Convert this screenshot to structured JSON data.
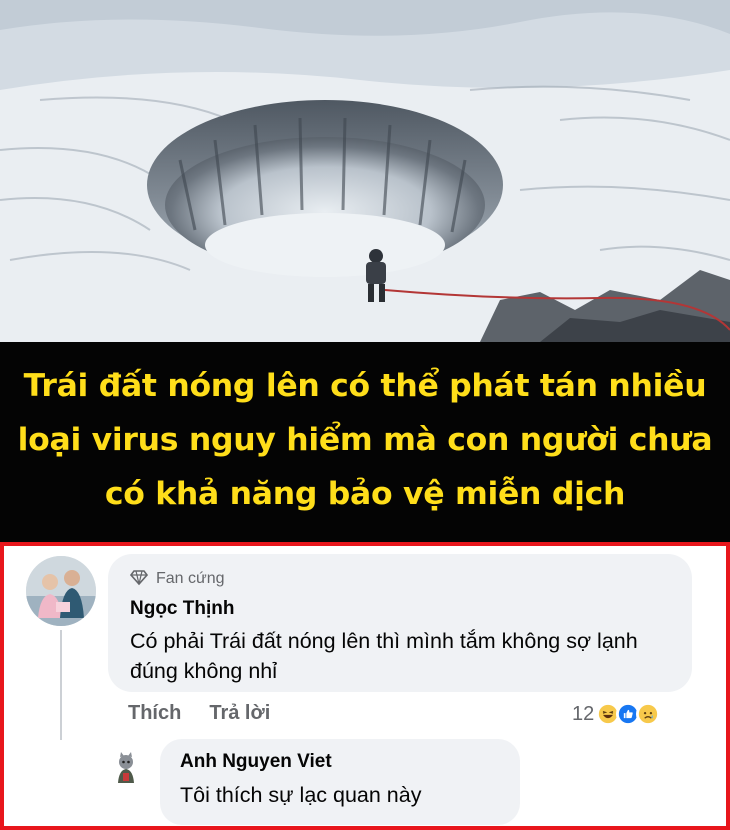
{
  "post": {
    "headline": "Trái đất nóng lên có thể phát tán nhiều loại virus nguy hiểm mà con người chưa có khả năng bảo vệ miễn dịch"
  },
  "comments": [
    {
      "badge": "Fan cứng",
      "author": "Ngọc Thịnh",
      "text": "Có phải Trái đất nóng lên thì mình tắm không sợ lạnh đúng không nhỉ",
      "actions": {
        "like": "Thích",
        "reply": "Trả lời"
      },
      "reaction_count": "12",
      "reaction_icons": [
        "haha-icon",
        "like-icon",
        "sad-icon"
      ]
    },
    {
      "author": "Anh Nguyen Viet",
      "text": "Tôi thích sự lạc quan này"
    }
  ],
  "colors": {
    "banner_bg": "#040404",
    "headline": "#ffde1a",
    "frame_border": "#e8161c",
    "bubble_bg": "#f0f2f5",
    "meta_text": "#65676b",
    "like_blue": "#1877f2"
  }
}
